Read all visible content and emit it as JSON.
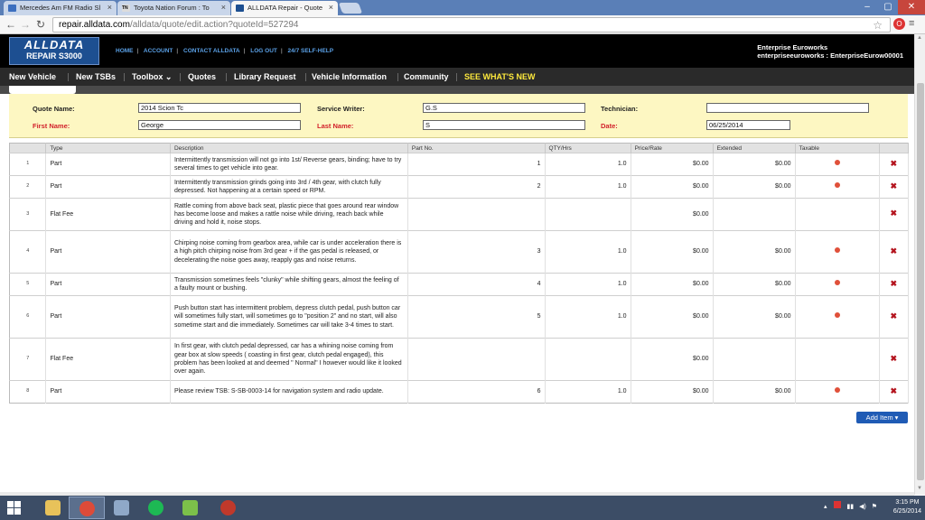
{
  "browser": {
    "tabs": [
      {
        "title": "Mercedes Am FM Radio Sl",
        "icon_color": "#3c6fbf"
      },
      {
        "title": "Toyota Nation Forum : To",
        "icon_color": "#222222",
        "icon_text": "TN"
      },
      {
        "title": "ALLDATA Repair - Quote",
        "icon_color": "#1d4f91",
        "active": true
      }
    ],
    "url_host": "repair.alldata.com",
    "url_path": "/alldata/quote/edit.action?quoteId=527294"
  },
  "header": {
    "logo_line1": "ALLDATA",
    "logo_line2": "REPAIR S3000",
    "links": [
      "HOME",
      "ACCOUNT",
      "CONTACT ALLDATA",
      "LOG OUT",
      "24/7 SELF-HELP"
    ],
    "account_name": "Enterprise Euroworks",
    "account_id": "enterpriseeuroworks : EnterpriseEurow00001"
  },
  "nav": {
    "items": [
      "New Vehicle",
      "New TSBs",
      "Toolbox ⌄",
      "Quotes",
      "Library Request",
      "Vehicle Information",
      "Community"
    ],
    "highlight": "SEE WHAT'S NEW"
  },
  "form": {
    "quote_name_label": "Quote Name:",
    "quote_name": "2014 Scion Tc",
    "service_writer_label": "Service Writer:",
    "service_writer": "G.S",
    "technician_label": "Technician:",
    "technician": "",
    "first_name_label": "First Name:",
    "first_name": "George",
    "last_name_label": "Last Name:",
    "last_name": "S",
    "date_label": "Date:",
    "date": "06/25/2014"
  },
  "table": {
    "headers": [
      "",
      "Type",
      "Description",
      "Part No.",
      "QTY/Hrs",
      "Price/Rate",
      "Extended",
      "Taxable",
      ""
    ],
    "rows": [
      {
        "num": "1",
        "type": "Part",
        "description": "Intermittently transmission will not go into 1st/ Reverse gears, binding; have to try several times to get vehicle into gear.",
        "part_no": "1",
        "qty": "1.0",
        "price": "$0.00",
        "extended": "$0.00",
        "taxable": true
      },
      {
        "num": "2",
        "type": "Part",
        "description": "Intermittently transmission grinds going into 3rd / 4th gear, with clutch fully depressed. Not happening at a certain speed or RPM.",
        "part_no": "2",
        "qty": "1.0",
        "price": "$0.00",
        "extended": "$0.00",
        "taxable": true
      },
      {
        "num": "3",
        "type": "Flat Fee",
        "description": "Rattle coming from above back seat, plastic piece that goes around rear window has become loose and makes a rattle noise while driving, reach back while driving and hold it, noise stops.",
        "part_no": "",
        "qty": "",
        "price": "$0.00",
        "extended": "",
        "taxable": false
      },
      {
        "num": "4",
        "type": "Part",
        "description": "Chirping noise coming from gearbox area, while car is under acceleration there is a high pitch chirping noise from 3rd gear + if the gas pedal is released, or decelerating the noise goes away, reapply gas and noise returns.",
        "part_no": "3",
        "qty": "1.0",
        "price": "$0.00",
        "extended": "$0.00",
        "taxable": true
      },
      {
        "num": "5",
        "type": "Part",
        "description": "Transmission sometimes feels \"clunky\" while shifting gears, almost the feeling of a faulty mount or bushing.",
        "part_no": "4",
        "qty": "1.0",
        "price": "$0.00",
        "extended": "$0.00",
        "taxable": true
      },
      {
        "num": "6",
        "type": "Part",
        "description": "Push button start has intermittent problem, depress clutch pedal, push button car will sometimes fully start, will sometimes go to \"position 2\" and no start, will also sometime start and die immediately. Sometimes car will take 3-4 times to start.",
        "part_no": "5",
        "qty": "1.0",
        "price": "$0.00",
        "extended": "$0.00",
        "taxable": true
      },
      {
        "num": "7",
        "type": "Flat Fee",
        "description": "In first gear, with clutch pedal depressed, car has a whining noise coming from gear box at slow speeds ( coasting in first gear, clutch pedal engaged), this problem has been looked at and deemed \" Normal\" I however would like it looked over again.",
        "part_no": "",
        "qty": "",
        "price": "$0.00",
        "extended": "",
        "taxable": false
      },
      {
        "num": "8",
        "type": "Part",
        "description": "Please review TSB: S-SB-0003-14 for navigation system and radio update.",
        "part_no": "6",
        "qty": "1.0",
        "price": "$0.00",
        "extended": "$0.00",
        "taxable": true
      }
    ]
  },
  "add_item_label": "Add Item ▾",
  "taskbar": {
    "time": "3:15 PM",
    "date": "6/25/2014",
    "apps": [
      {
        "name": "file-explorer",
        "color": "#e8c25a"
      },
      {
        "name": "chrome",
        "color": "#dd4b39"
      },
      {
        "name": "calculator",
        "color": "#8fa8c8"
      },
      {
        "name": "spotify",
        "color": "#1db954"
      },
      {
        "name": "game",
        "color": "#7cc04a"
      },
      {
        "name": "recorder",
        "color": "#c0392b"
      }
    ]
  }
}
